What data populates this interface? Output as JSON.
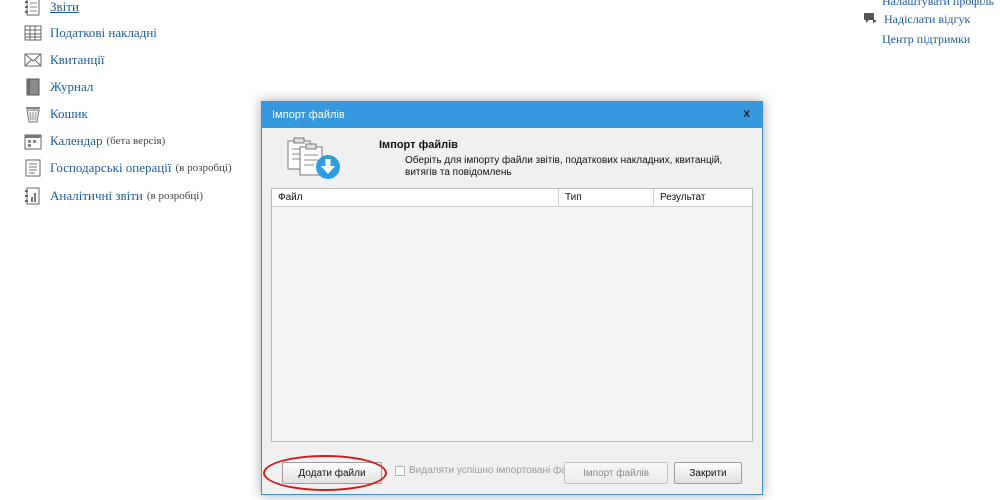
{
  "nav": {
    "items": [
      {
        "label": "Звіти",
        "note": "",
        "icon": "reports-icon"
      },
      {
        "label": "Податкові накладні",
        "note": "",
        "icon": "table-icon"
      },
      {
        "label": "Квитанції",
        "note": "",
        "icon": "envelope-icon"
      },
      {
        "label": "Журнал",
        "note": "",
        "icon": "book-icon"
      },
      {
        "label": "Кошик",
        "note": "",
        "icon": "trash-icon"
      },
      {
        "label": "Календар",
        "note": "(бета версія)",
        "icon": "calendar-icon"
      },
      {
        "label": "Господарські операції",
        "note": "(в розробці)",
        "icon": "document-icon"
      },
      {
        "label": "Аналітичні звіти",
        "note": "(в розробці)",
        "icon": "chart-icon"
      }
    ]
  },
  "right_links": {
    "profile": "Налаштувати профіль",
    "feedback": "Надіслати відгук",
    "support": "Центр підтримки"
  },
  "dialog": {
    "title": "Імпорт файлів",
    "close": "x",
    "heading": "Імпорт файлів",
    "description": "Оберіть для імпорту файли звітів, податкових накладних, квитанцій, витягів та повідомлень",
    "columns": [
      "Файл",
      "Тип",
      "Результат"
    ],
    "add_button": "Додати файли",
    "checkbox_label": "Видаляти успішно імпортовані файли",
    "import_button": "Імпорт файлів",
    "close_button": "Закрити"
  },
  "colors": {
    "link": "#1f5a9c",
    "titlebar": "#3599e0",
    "annotation": "#d11a1a"
  }
}
